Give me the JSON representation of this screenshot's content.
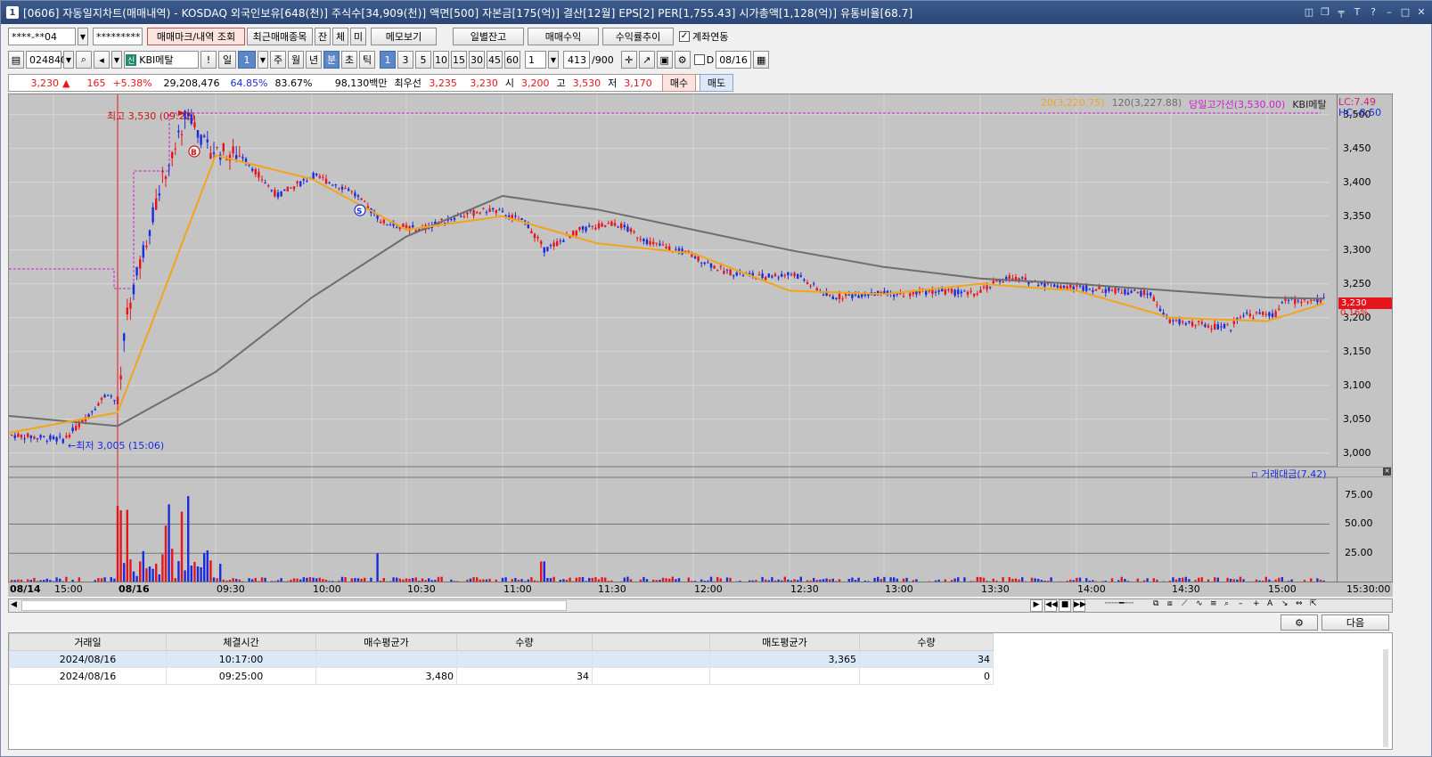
{
  "window": {
    "title": "[0606] 자동일지차트(매매내역) - KOSDAQ 외국인보유[648(천)] 주식수[34,909(천)] 액면[500] 자본금[175(억)] 결산[12월] EPS[2] PER[1,755.43] 시가총액[1,128(억)] 유통비율[68.7]",
    "icon_label": "1"
  },
  "toolbar1": {
    "account": "****-**04",
    "password": "*********",
    "trade_mark_btn": "매매마크/내역 조회",
    "recent_btn": "최근매매종목",
    "tab_jan": "잔",
    "tab_che": "체",
    "tab_mi": "미",
    "memo_btn": "메모보기",
    "daily_btn": "일별잔고",
    "profit_btn": "매매수익",
    "trend_btn": "수익률추이",
    "link_label": "계좌연동"
  },
  "toolbar2": {
    "code": "024840",
    "stock_name": "KBI메탈",
    "stock_badge": "신",
    "exclaim": "!",
    "period_day": "일",
    "period_num": "1",
    "period_week": "주",
    "period_month": "월",
    "period_year": "년",
    "min_label": "분",
    "sec_label": "초",
    "tick_label": "틱",
    "intervals": [
      "1",
      "3",
      "5",
      "10",
      "15",
      "30",
      "45",
      "60"
    ],
    "multiplier": "1",
    "count": "413",
    "count_total": "/900",
    "date_check_label": "D",
    "date_value": "08/16"
  },
  "quote": {
    "price": "3,230",
    "arrow": "▲",
    "change": "165",
    "change_pct": "+5.38%",
    "volume": "29,208,476",
    "vol_ratio": "64.85%",
    "turnover": "83.67%",
    "amount": "98,130백만",
    "best_label": "최우선",
    "best_ask": "3,235",
    "best_bid": "3,230",
    "open_label": "시",
    "open": "3,200",
    "high_label": "고",
    "high": "3,530",
    "low_label": "저",
    "low": "3,170",
    "buy_btn": "매수",
    "sell_btn": "매도"
  },
  "chart_legend": {
    "ma20": "20(3,220.75)",
    "ma120": "120(3,227.88)",
    "day_high": "당일고가선(3,530.00)",
    "stock": "KBI메탈",
    "lc": "LC:7.49",
    "hc": "HC:-8.50",
    "vol_title": "거래대금(7.42)",
    "annot_high": "최고 3,530 (09:22)",
    "annot_low": "←최저 3,005 (15:06)",
    "current_price": "3,230",
    "current_pct": "0.16%",
    "buy_mark": "B",
    "sell_mark": "S"
  },
  "colors": {
    "up": "#e8141c",
    "down": "#1b2bde",
    "ma20": "#f2a51a",
    "ma120": "#6e6e6e",
    "high_line": "#d01fd0",
    "background": "#c4c4c4"
  },
  "price_axis": [
    "3,500",
    "3,450",
    "3,400",
    "3,350",
    "3,300",
    "3,250",
    "3,200",
    "3,150",
    "3,100",
    "3,050",
    "3,000"
  ],
  "volume_axis": [
    "75.00",
    "50.00",
    "25.00"
  ],
  "time_axis": [
    "08/14",
    "15:00",
    "08/16",
    "09:30",
    "10:00",
    "10:30",
    "11:00",
    "11:30",
    "12:00",
    "12:30",
    "13:00",
    "13:30",
    "14:00",
    "14:30",
    "15:00",
    "15:30:00"
  ],
  "bottom": {
    "next_btn": "다음",
    "columns": [
      "거래일",
      "체결시간",
      "매수평균가",
      "수량",
      "",
      "매도평균가",
      "수량"
    ],
    "rows": [
      [
        "2024/08/16",
        "10:17:00",
        "",
        "",
        "",
        "3,365",
        "34"
      ],
      [
        "2024/08/16",
        "09:25:00",
        "3,480",
        "34",
        "",
        "",
        "0"
      ]
    ]
  },
  "chart_data": {
    "type": "line",
    "title": "",
    "series": [
      {
        "name": "20",
        "x": [
          "08/14 14:40",
          "08/16 09:00",
          "09:30",
          "10:00",
          "10:30",
          "11:00",
          "11:30",
          "12:00",
          "12:30",
          "13:00",
          "13:30",
          "14:00",
          "14:30",
          "15:00",
          "15:20"
        ],
        "values": [
          3030,
          3060,
          3440,
          3405,
          3330,
          3350,
          3310,
          3295,
          3240,
          3235,
          3250,
          3240,
          3200,
          3195,
          3221
        ]
      },
      {
        "name": "120",
        "x": [
          "08/14 14:40",
          "08/16 09:00",
          "09:30",
          "10:00",
          "10:30",
          "11:00",
          "11:30",
          "12:00",
          "12:30",
          "13:00",
          "13:30",
          "14:00",
          "14:30",
          "15:00",
          "15:20"
        ],
        "values": [
          3055,
          3040,
          3120,
          3230,
          3320,
          3380,
          3360,
          3330,
          3300,
          3275,
          3258,
          3250,
          3240,
          3230,
          3228
        ]
      }
    ],
    "ylim": [
      2980,
      3530
    ],
    "volume_ylim": [
      0,
      90
    ]
  }
}
